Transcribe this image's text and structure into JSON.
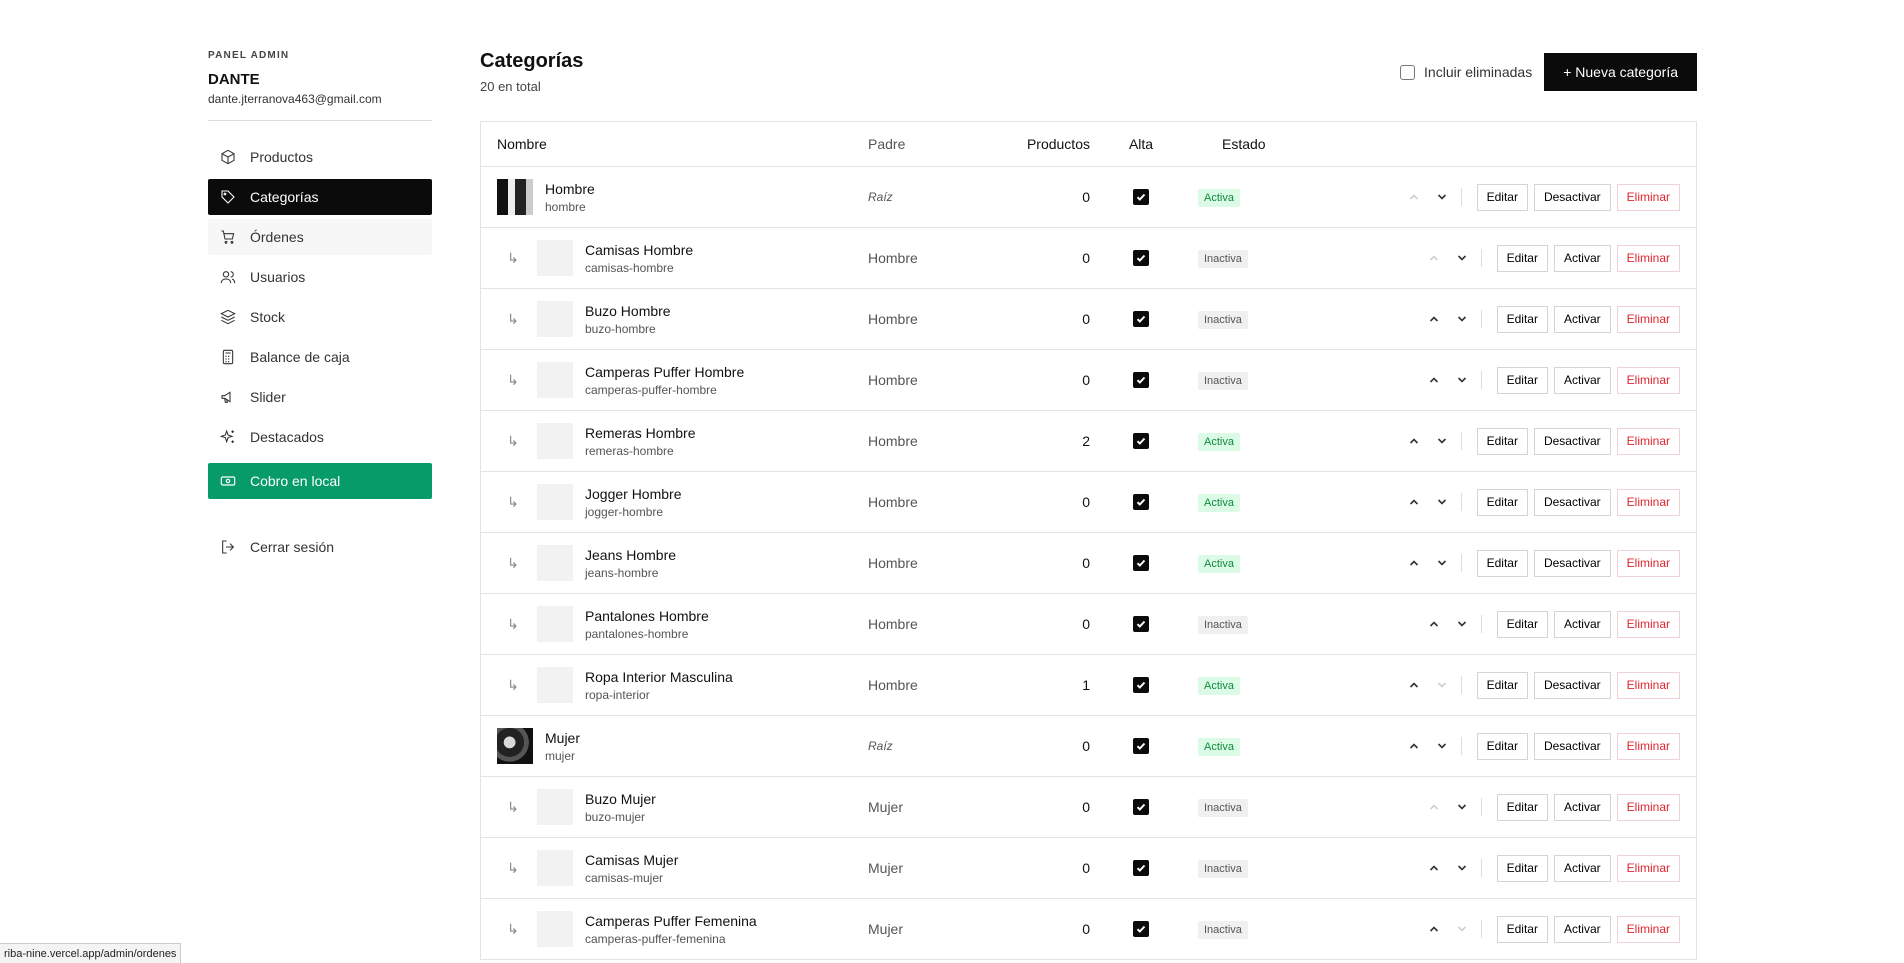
{
  "sidebar": {
    "panel_label": "PANEL ADMIN",
    "user_name": "DANTE",
    "user_email": "dante.jterranova463@gmail.com",
    "items": [
      {
        "label": "Productos",
        "icon": "box-icon"
      },
      {
        "label": "Categorías",
        "icon": "tag-icon"
      },
      {
        "label": "Órdenes",
        "icon": "cart-icon"
      },
      {
        "label": "Usuarios",
        "icon": "users-icon"
      },
      {
        "label": "Stock",
        "icon": "layers-icon"
      },
      {
        "label": "Balance de caja",
        "icon": "calculator-icon"
      },
      {
        "label": "Slider",
        "icon": "megaphone-icon"
      },
      {
        "label": "Destacados",
        "icon": "sparkles-icon"
      }
    ],
    "cobro_label": "Cobro en local",
    "logout_label": "Cerrar sesión"
  },
  "main": {
    "title": "Categorías",
    "subtitle": "20 en total",
    "include_deleted_label": "Incluir eliminadas",
    "new_button_label": "+ Nueva categoría"
  },
  "table": {
    "headers": {
      "name": "Nombre",
      "parent": "Padre",
      "products": "Productos",
      "alta": "Alta",
      "estado": "Estado"
    },
    "buttons": {
      "edit": "Editar",
      "activate": "Activar",
      "deactivate": "Desactivar",
      "delete": "Eliminar"
    },
    "rows": [
      {
        "name": "Hombre",
        "slug": "hombre",
        "parent": "Raíz",
        "products": "0",
        "status": "Activa",
        "root": true,
        "image": "hombre"
      },
      {
        "name": "Camisas Hombre",
        "slug": "camisas-hombre",
        "parent": "Hombre",
        "products": "0",
        "status": "Inactiva"
      },
      {
        "name": "Buzo Hombre",
        "slug": "buzo-hombre",
        "parent": "Hombre",
        "products": "0",
        "status": "Inactiva"
      },
      {
        "name": "Camperas Puffer Hombre",
        "slug": "camperas-puffer-hombre",
        "parent": "Hombre",
        "products": "0",
        "status": "Inactiva"
      },
      {
        "name": "Remeras Hombre",
        "slug": "remeras-hombre",
        "parent": "Hombre",
        "products": "2",
        "status": "Activa"
      },
      {
        "name": "Jogger Hombre",
        "slug": "jogger-hombre",
        "parent": "Hombre",
        "products": "0",
        "status": "Activa"
      },
      {
        "name": "Jeans Hombre",
        "slug": "jeans-hombre",
        "parent": "Hombre",
        "products": "0",
        "status": "Activa"
      },
      {
        "name": "Pantalones Hombre",
        "slug": "pantalones-hombre",
        "parent": "Hombre",
        "products": "0",
        "status": "Inactiva"
      },
      {
        "name": "Ropa Interior Masculina",
        "slug": "ropa-interior",
        "parent": "Hombre",
        "products": "1",
        "status": "Activa"
      },
      {
        "name": "Mujer",
        "slug": "mujer",
        "parent": "Raíz",
        "products": "0",
        "status": "Activa",
        "root": true,
        "image": "mujer"
      },
      {
        "name": "Buzo Mujer",
        "slug": "buzo-mujer",
        "parent": "Mujer",
        "products": "0",
        "status": "Inactiva"
      },
      {
        "name": "Camisas Mujer",
        "slug": "camisas-mujer",
        "parent": "Mujer",
        "products": "0",
        "status": "Inactiva"
      },
      {
        "name": "Camperas Puffer Femenina",
        "slug": "camperas-puffer-femenina",
        "parent": "Mujer",
        "products": "0",
        "status": "Inactiva"
      }
    ]
  },
  "statusbar": {
    "url": "riba-nine.vercel.app/admin/ordenes"
  }
}
